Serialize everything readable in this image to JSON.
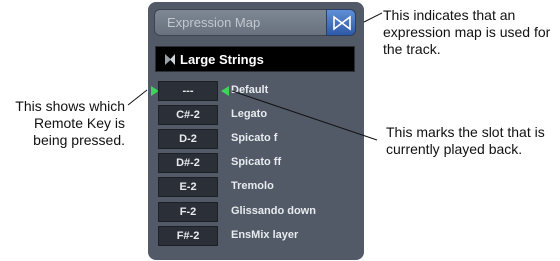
{
  "panel": {
    "title": "Expression Map",
    "map_name": "Large Strings"
  },
  "slots": [
    {
      "key": "---",
      "name": "Default"
    },
    {
      "key": "C#-2",
      "name": "Legato"
    },
    {
      "key": "D-2",
      "name": "Spicato f"
    },
    {
      "key": "D#-2",
      "name": "Spicato ff"
    },
    {
      "key": "E-2",
      "name": "Tremolo"
    },
    {
      "key": "F-2",
      "name": "Glissando down"
    },
    {
      "key": "F#-2",
      "name": "EnsMix layer"
    }
  ],
  "annotations": {
    "expression_map": "This indicates that an expression map is used for the track.",
    "remote_key": "This shows which Remote Key is being pressed.",
    "slot_played": "This marks the slot that is currently played back."
  },
  "colors": {
    "panel_bg": "#515a66",
    "accent_blue": "#3f6fc0",
    "indicator_green": "#3fd35a"
  },
  "icons": {
    "expression_map_button": "expression-map-icon",
    "remote_key_indicator": "triangle-right-icon",
    "playback_indicator": "triangle-left-icon"
  }
}
